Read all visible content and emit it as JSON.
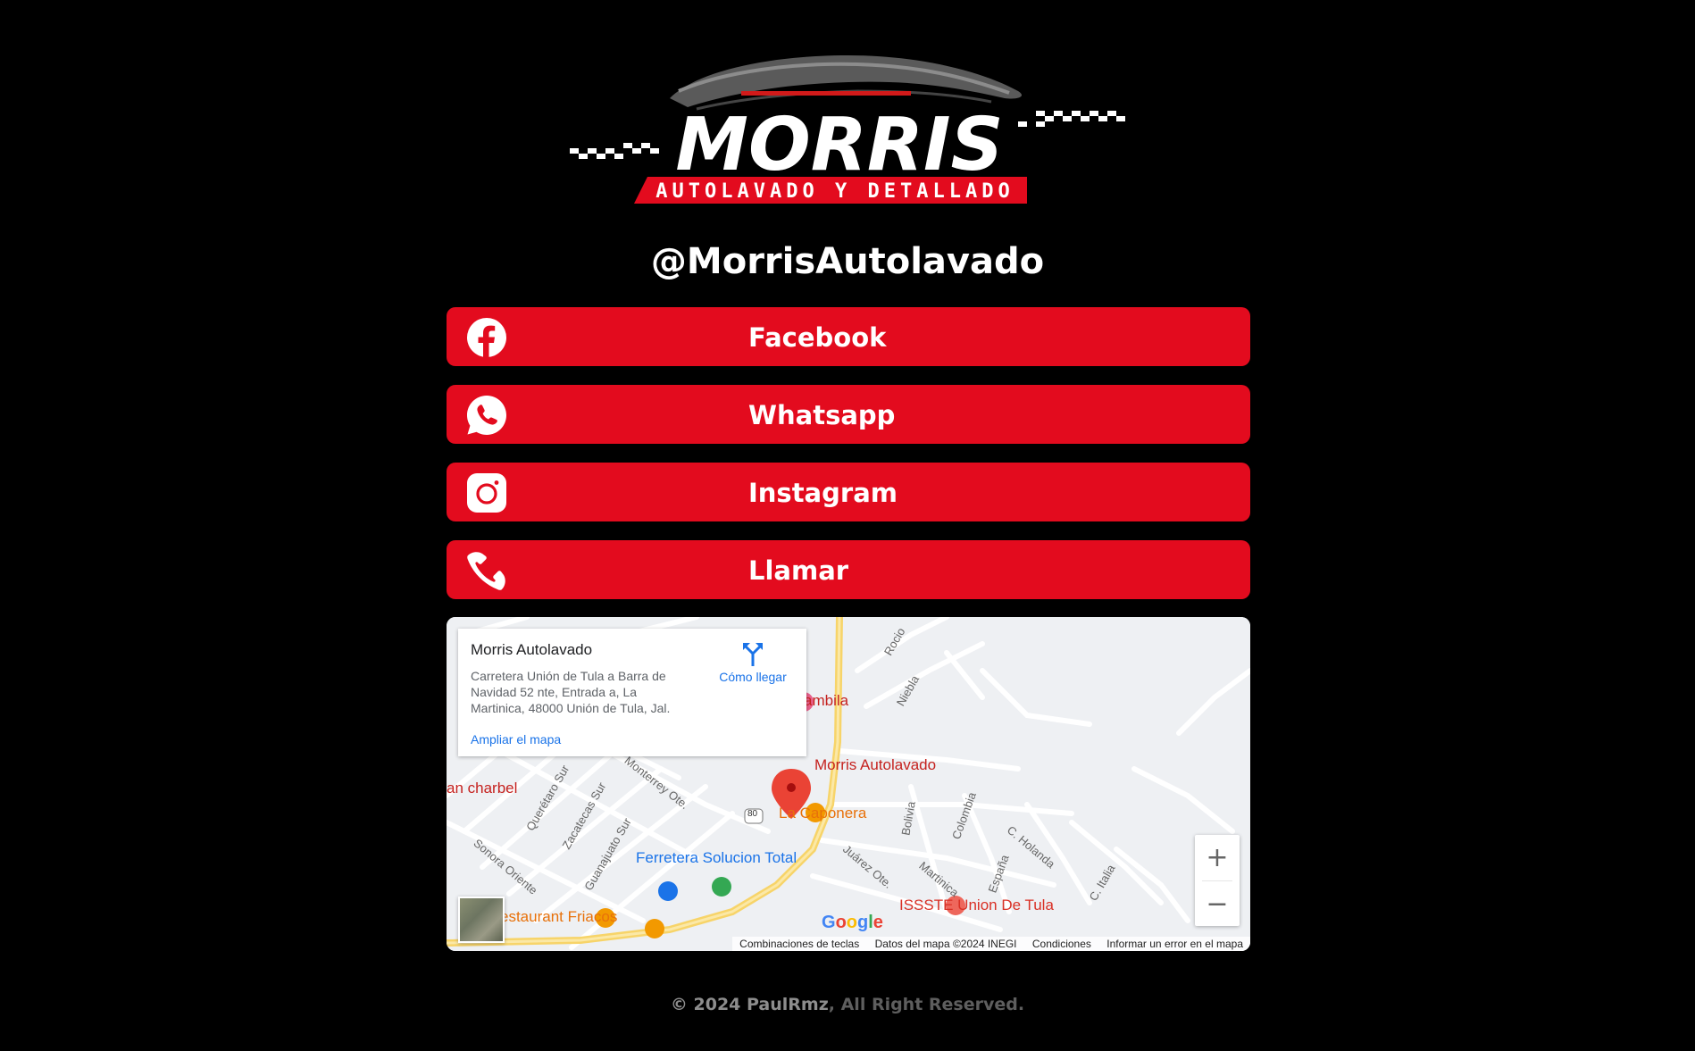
{
  "brand": {
    "logo_word": "MORRIS",
    "logo_tagline": "AUTOLAVADO Y DETALLADO",
    "handle": "@MorrisAutolavado"
  },
  "links": [
    {
      "label": "Facebook",
      "icon": "facebook-icon"
    },
    {
      "label": "Whatsapp",
      "icon": "whatsapp-icon"
    },
    {
      "label": "Instagram",
      "icon": "instagram-icon"
    },
    {
      "label": "Llamar",
      "icon": "phone-icon"
    }
  ],
  "map": {
    "card": {
      "name": "Morris Autolavado",
      "address": "Carretera Unión de Tula a Barra de Navidad 52 nte, Entrada a, La Martinica, 48000 Unión de Tula, Jal.",
      "directions": "Cómo llegar",
      "enlarge": "Ampliar el mapa"
    },
    "pin_label": "Morris Autolavado",
    "places": {
      "caponera": "La Caponera",
      "ferreteria": "Ferretera Solucion Total",
      "issste": "ISSSTE Union De Tula",
      "friacos": "estaurant Friacos",
      "charbel": "an charbel",
      "bambila": "ambila"
    },
    "streets": {
      "rocio": "Rocio",
      "niebla": "Niebla",
      "monterrey": "Monterrey Ote.",
      "queretaro": "Querétaro Sur",
      "zacatecas": "Zacatecas Sur",
      "guanajuato": "Guanajuato Sur",
      "sonora": "Sonora Oriente",
      "juarez": "Juárez Ote.",
      "martinica": "Martinica",
      "bolivia": "Bolivia",
      "colombia": "Colombia",
      "espana": "España",
      "holanda": "C. Holanda",
      "italia": "C. Italia",
      "hwy": "80"
    },
    "zoom_in": "+",
    "zoom_out": "−",
    "google": "Google",
    "attribution": {
      "shortcuts": "Combinaciones de teclas",
      "data": "Datos del mapa ©2024 INEGI",
      "terms": "Condiciones",
      "report": "Informar un error en el mapa"
    }
  },
  "footer": {
    "copyright": "© 2024 PaulRmz",
    "rights": ", All Right Reserved."
  },
  "colors": {
    "background": "#000000",
    "button": "#e30b1e",
    "text": "#ffffff"
  }
}
